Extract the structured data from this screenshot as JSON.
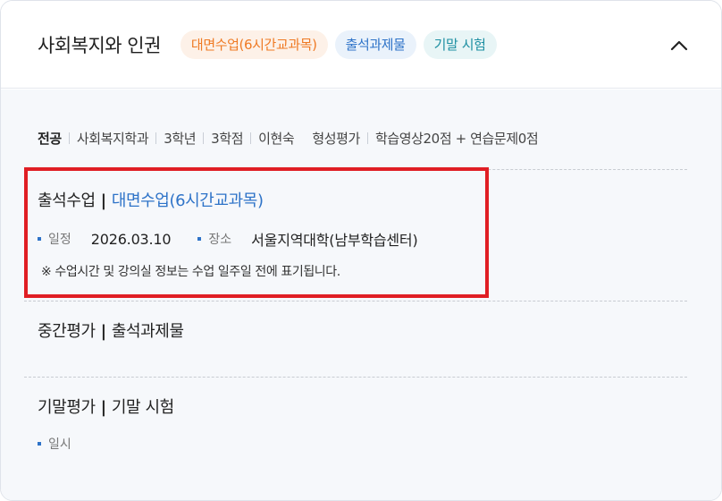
{
  "header": {
    "title": "사회복지와 인권",
    "chips": [
      {
        "label": "대면수업(6시간교과목)",
        "color": "#ef7a24"
      },
      {
        "label": "출석과제물",
        "color": "#2e73c8"
      },
      {
        "label": "기말 시험",
        "color": "#1d8fa2"
      }
    ]
  },
  "meta": {
    "category": "전공",
    "department": "사회복지학과",
    "grade": "3학년",
    "credits": "3학점",
    "professor": "이현숙",
    "evaluation_label": "형성평가",
    "evaluation_detail": "학습영상20점 + 연습문제0점"
  },
  "attendance": {
    "title": "출석수업",
    "separator": "|",
    "type": "대면수업(6시간교과목)",
    "date_label": "일정",
    "date_value": "2026.03.10",
    "place_label": "장소",
    "place_value": "서울지역대학(남부학습센터)",
    "note": "※ 수업시간 및 강의실 정보는 수업 일주일 전에 표기됩니다."
  },
  "midterm": {
    "title": "중간평가",
    "separator": "|",
    "type": "출석과제물"
  },
  "final": {
    "title": "기말평가",
    "separator": "|",
    "type": "기말 시험",
    "date_label": "일시"
  },
  "colors": {
    "accent_blue": "#2e73c8",
    "accent_orange": "#ef7a24",
    "accent_teal": "#1d8fa2",
    "highlight_red": "#e01e24"
  }
}
